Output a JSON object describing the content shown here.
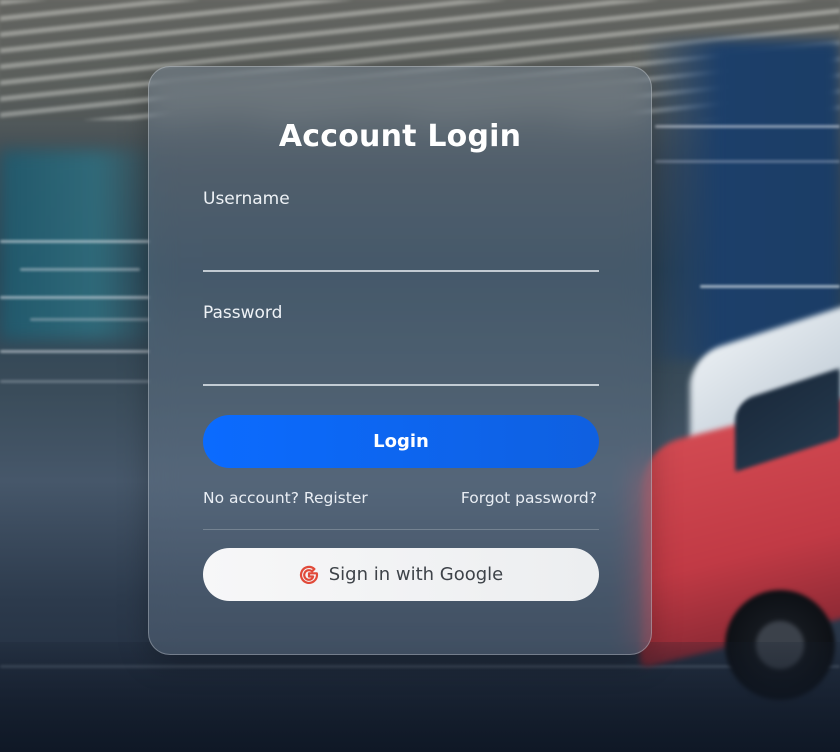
{
  "login": {
    "title": "Account Login",
    "username_label": "Username",
    "username_value": "",
    "password_label": "Password",
    "password_value": "",
    "login_button": "Login",
    "register_link": "No account? Register",
    "forgot_link": "Forgot password?",
    "google_button": "Sign in with Google",
    "google_icon": "google-g-icon"
  },
  "colors": {
    "accent": "#0b6bff",
    "google_red": "#e14a3a"
  }
}
